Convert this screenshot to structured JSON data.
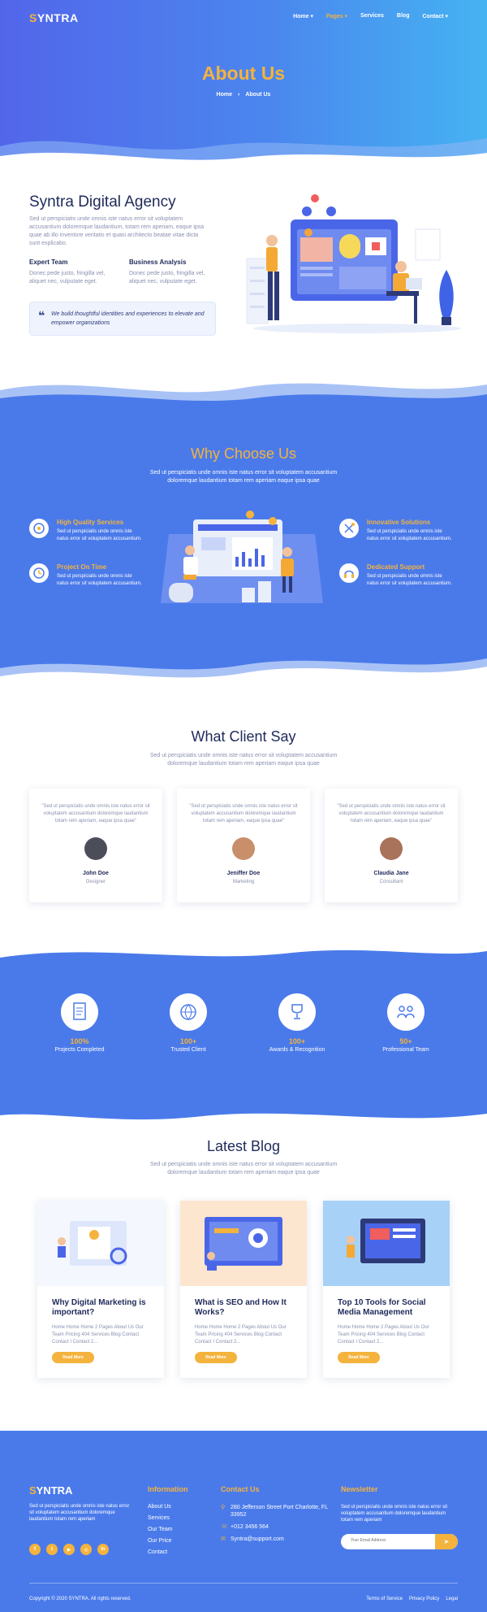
{
  "brand": {
    "logo_first": "S",
    "logo_rest": "YNTRA"
  },
  "nav": [
    {
      "label": "Home ▾",
      "active": false
    },
    {
      "label": "Pages ▾",
      "active": true
    },
    {
      "label": "Services",
      "active": false
    },
    {
      "label": "Blog",
      "active": false
    },
    {
      "label": "Contact ▾",
      "active": false
    }
  ],
  "hero": {
    "title": "About Us",
    "crumb_home": "Home",
    "crumb_sep": "›",
    "crumb_current": "About Us"
  },
  "about": {
    "title": "Syntra Digital Agency",
    "desc": "Sed ut perspiciatis unde omnis iste natus error sit voluptatem accusantium doloremque laudantium, totam rem aperiam, eaque ipsa quae ab illo inventore veritatis et quasi architecto beatae vitae dicta sunt explicabo.",
    "features": [
      {
        "title": "Expert Team",
        "desc": "Donec pede justo, fringilla vel, aliquet nec, vulputate eget."
      },
      {
        "title": "Business Analysis",
        "desc": "Donec pede justo, fringilla vel, aliquet nec, vulputate eget."
      }
    ],
    "quote_mark": "❝",
    "quote": "We build thoughtful identities and experiences to elevate and empower organizations"
  },
  "why": {
    "title": "Why Choose Us",
    "sub": "Sed ut perspiciatis unde omnis iste natus error sit voluptatem accusantium doloremque laudantium totam rem aperiam eaque ipsa quae",
    "items": [
      {
        "title": "High Quality Services",
        "desc": "Sed ut perspiciatis unde omnis iste natus error sit voluptatem accusantium.",
        "icon": "target-icon"
      },
      {
        "title": "Project On Time",
        "desc": "Sed ut perspiciatis unde omnis iste natus error sit voluptatem accusantium.",
        "icon": "clock-icon"
      },
      {
        "title": "Innovative Solutions",
        "desc": "Sed ut perspiciatis unde omnis iste natus error sit voluptatem accusantium.",
        "icon": "tools-icon"
      },
      {
        "title": "Dedicated Support",
        "desc": "Sed ut perspiciatis unde omnis iste natus error sit voluptatem accusantium.",
        "icon": "headset-icon"
      }
    ]
  },
  "clients": {
    "title": "What Client Say",
    "sub": "Sed ut perspiciatis unde omnis iste natus error sit voluptatem accusantium doloremque laudantium totam rem aperiam eaque ipsa quae",
    "items": [
      {
        "quote": "\"Sed ut perspiciatis unde omnis iste natus error sit voluptatem accusantium doloremque laudantium totam rem aperiam, eaque ipsa quae\"",
        "name": "John Doe",
        "role": "Designer",
        "avatar_color": "#4b4e58"
      },
      {
        "quote": "\"Sed ut perspiciatis unde omnis iste natus error sit voluptatem accusantium doloremque laudantium totam rem aperiam, eaque ipsa quae\"",
        "name": "Jeniffer Doe",
        "role": "Marketing",
        "avatar_color": "#c98f6a"
      },
      {
        "quote": "\"Sed ut perspiciatis unde omnis iste natus error sit voluptatem accusantium doloremque laudantium totam rem aperiam, eaque ipsa quae\"",
        "name": "Claudia Jane",
        "role": "Consultant",
        "avatar_color": "#a8735a"
      }
    ]
  },
  "counters": [
    {
      "num": "100%",
      "label": "Projects Completed",
      "icon": "document-icon"
    },
    {
      "num": "100+",
      "label": "Trusted Client",
      "icon": "globe-icon"
    },
    {
      "num": "100+",
      "label": "Awards & Recognition",
      "icon": "trophy-icon"
    },
    {
      "num": "50+",
      "label": "Professional Team",
      "icon": "team-icon"
    }
  ],
  "blog": {
    "title": "Latest Blog",
    "sub": "Sed ut perspiciatis unde omnis iste natus error sit voluptatem accusantium doloremque laudantium totam rem aperiam eaque ipsa quae",
    "posts": [
      {
        "title": "Why Digital Marketing is important?",
        "excerpt": "Home Home Home 2 Pages About Us Our Team Pricing 404 Services Blog Contact Contact I Contact 2...",
        "btn": "Read More"
      },
      {
        "title": "What is SEO and How It Works?",
        "excerpt": "Home Home Home 2 Pages About Us Our Team Pricing 404 Services Blog Contact Contact I Contact 2...",
        "btn": "Read More"
      },
      {
        "title": "Top 10 Tools for Social Media Management",
        "excerpt": "Home Home Home 2 Pages About Us Our Team Pricing 404 Services Blog Contact Contact I Contact 2...",
        "btn": "Read More"
      }
    ]
  },
  "footer": {
    "desc": "Sed ut perspiciatis unde omnis iste natus error sit voluptatem accusantium doloremque laudantium totam rem aperiam",
    "socials": [
      "f",
      "t",
      "▶",
      "◎",
      "in"
    ],
    "info_title": "Information",
    "info_links": [
      "About Us",
      "Services",
      "Our Team",
      "Our Price",
      "Contact"
    ],
    "contact_title": "Contact Us",
    "contact": [
      {
        "icon": "⚲",
        "text": "280 Jefferson Street Port Charlotte, FL 33952"
      },
      {
        "icon": "☏",
        "text": "+012 3456 564"
      },
      {
        "icon": "✉",
        "text": "Syntra@support.com"
      }
    ],
    "news_title": "Newsletter",
    "news_desc": "Sed ut perspiciatis unde omnis iste natus error sit voluptatem accusantium doloremque laudantium totam rem aperiam",
    "news_placeholder": "Your Email Address",
    "news_send": "➤",
    "copyright": "Copyright © 2020 SYNTRA. All rights reserved.",
    "legal": [
      "Terms of Service",
      "Privacy Policy",
      "Legal"
    ]
  }
}
